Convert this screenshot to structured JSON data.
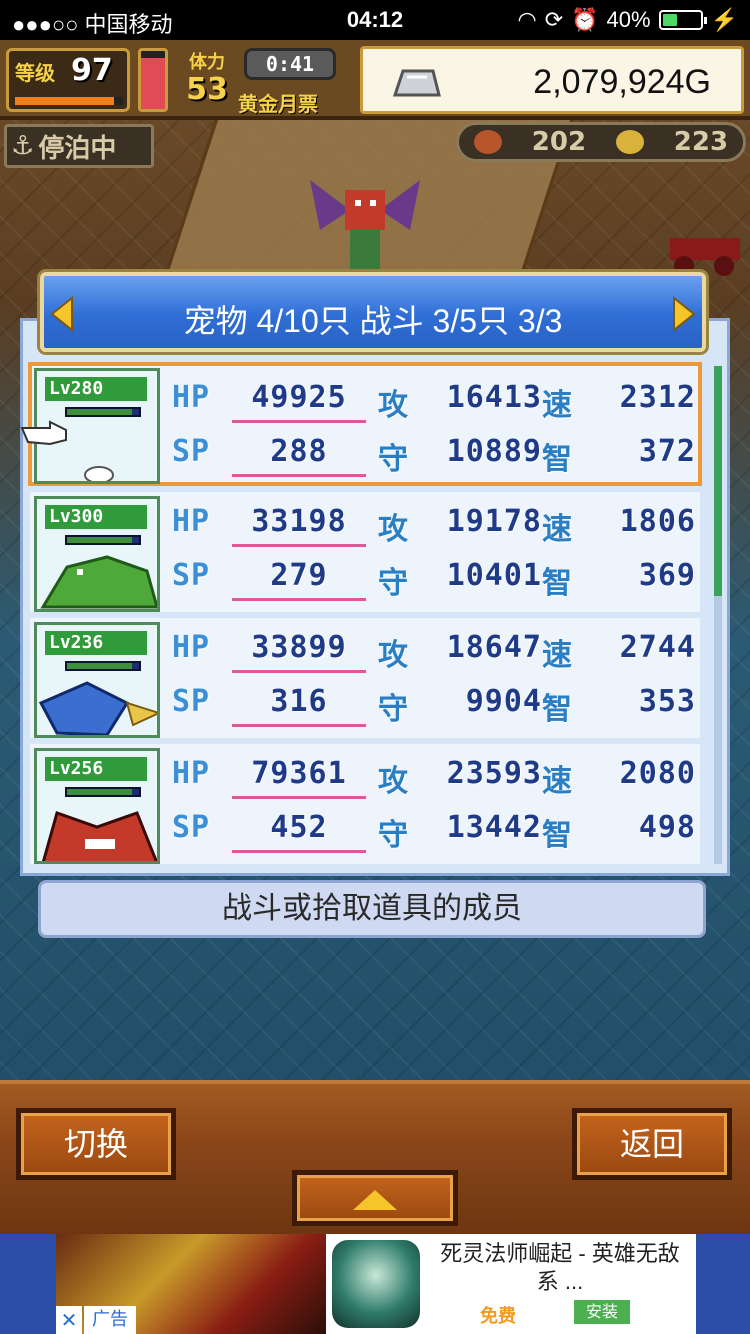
{
  "status_bar": {
    "carrier": "●●●○○ 中国移动",
    "time": "04:12",
    "battery": "40%",
    "battery_level": 0.4
  },
  "hud": {
    "level_label": "等级",
    "level": "97",
    "stamina_label": "体力",
    "stamina": "53",
    "timer": "0:41",
    "gold_ticket_label": "黄金月票",
    "money": "2,079,924G",
    "dock_status": "停泊中",
    "resource_a": "202",
    "resource_b": "223"
  },
  "panel": {
    "title": "宠物 4/10只 战斗 3/5只  3/3",
    "hint": "战斗或拾取道具的成员"
  },
  "stat_labels": {
    "hp": "HP",
    "sp": "SP",
    "atk": "攻",
    "def": "守",
    "spd": "速",
    "int": "智"
  },
  "pets": [
    {
      "level": "Lv280",
      "hp": "49925",
      "sp": "288",
      "atk": "16413",
      "def": "10889",
      "spd": "2312",
      "int": "372",
      "hp_fill": 0.9
    },
    {
      "level": "Lv300",
      "hp": "33198",
      "sp": "279",
      "atk": "19178",
      "def": "10401",
      "spd": "1806",
      "int": "369",
      "hp_fill": 0.9
    },
    {
      "level": "Lv236",
      "hp": "33899",
      "sp": "316",
      "atk": "18647",
      "def": "9904",
      "spd": "2744",
      "int": "353",
      "hp_fill": 0.9
    },
    {
      "level": "Lv256",
      "hp": "79361",
      "sp": "452",
      "atk": "23593",
      "def": "13442",
      "spd": "2080",
      "int": "498",
      "hp_fill": 0.9
    }
  ],
  "buttons": {
    "switch": "切换",
    "back": "返回"
  },
  "ad": {
    "title": "死灵法师崛起 - 英雄无敌系 ...",
    "free": "免费",
    "install": "安装",
    "close": "✕",
    "label": "广告"
  },
  "colors": {
    "panel_title_bg": "#2f6ed6",
    "selected_outline": "#ee9a3a",
    "stat_value": "#1f3a86",
    "underline": "#e0589a"
  }
}
